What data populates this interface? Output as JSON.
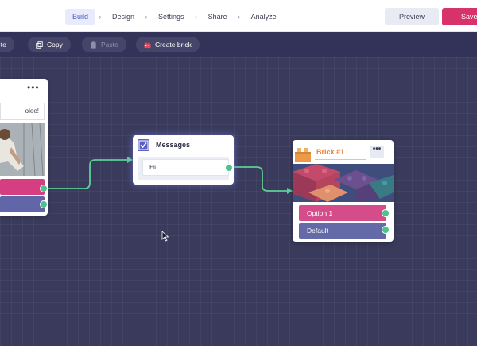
{
  "nav": {
    "steps": [
      "Build",
      "Design",
      "Settings",
      "Share",
      "Analyze"
    ],
    "active_step": "Build",
    "preview_label": "Preview",
    "save_label": "Save"
  },
  "toolbar": {
    "delete_label": "ete",
    "copy_label": "Copy",
    "paste_label": "Paste",
    "create_brick_label": "Create brick"
  },
  "nodes": {
    "left": {
      "message_text": "olee!"
    },
    "messages": {
      "title": "Messages",
      "bubble_text": "Hi"
    },
    "brick": {
      "title": "Brick #1",
      "option1": "Option 1",
      "option2": "Default"
    }
  },
  "colors": {
    "canvas": "#3a3a5c",
    "accent_pink": "#d7326a",
    "option_pink": "#d54c8a",
    "option_purple": "#646aa8",
    "connector_green": "#4cc38a",
    "brick_orange": "#e8843a"
  },
  "icons": {
    "copy": "copy-icon",
    "paste": "clipboard-icon",
    "create_brick": "brick-icon",
    "messages": "checkbox-icon",
    "menu": "more-dots-icon",
    "cursor": "mouse-pointer-icon"
  }
}
